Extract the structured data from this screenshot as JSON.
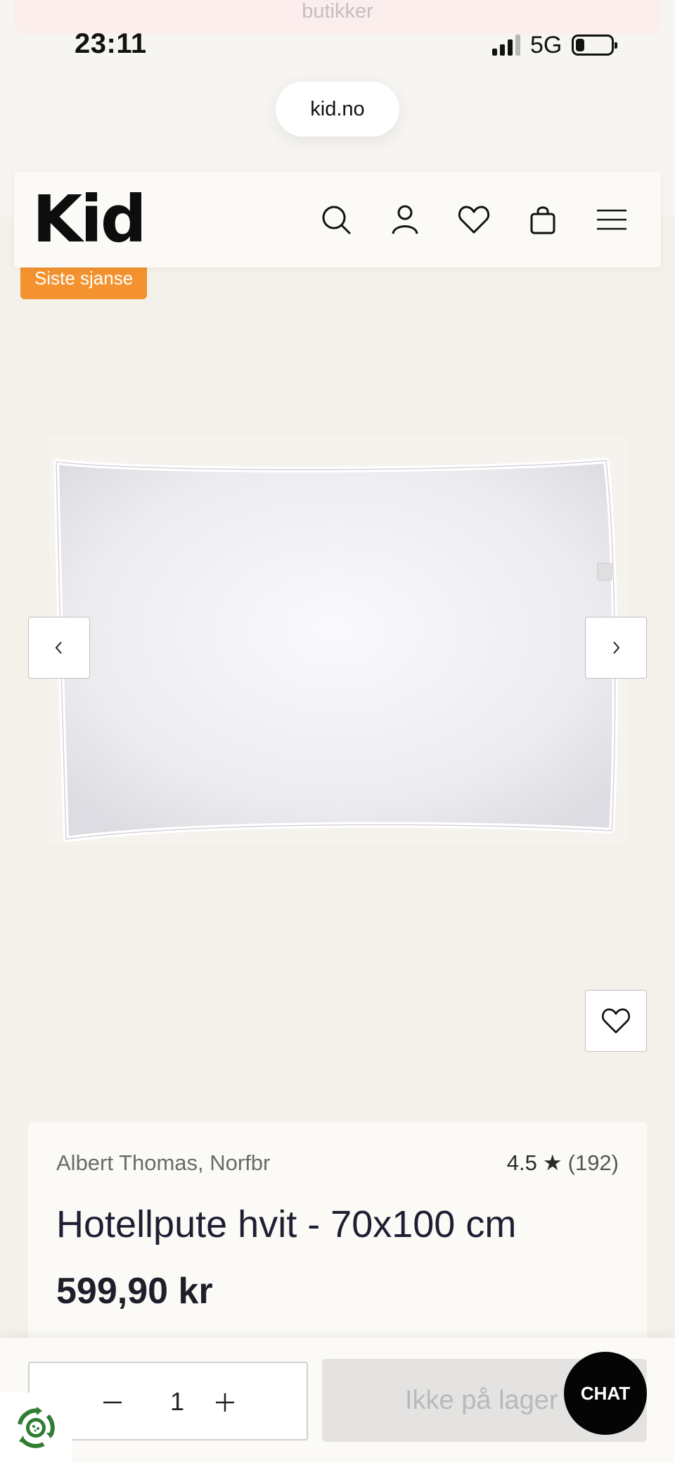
{
  "announcement": {
    "text": "butikker"
  },
  "status_bar": {
    "time": "23:11",
    "network": "5G",
    "battery_level": 0.2
  },
  "browser": {
    "url": "kid.no"
  },
  "header": {
    "logo": "Kid",
    "icons": [
      "search-icon",
      "account-icon",
      "heart-icon",
      "bag-icon",
      "menu-icon"
    ]
  },
  "product": {
    "badge": "Siste sjanse",
    "brand": "Albert Thomas, Norfbr",
    "rating": "4.5",
    "rating_star": "★",
    "review_count": "(192)",
    "title": "Hotellpute hvit - 70x100 cm",
    "price": "599,90 kr"
  },
  "cart": {
    "quantity": "1",
    "stock_label": "Ikke på lager",
    "chat_label": "CHAT"
  },
  "colors": {
    "background": "#f4f1ea",
    "badge": "#f4922f",
    "text": "#1f1f2b",
    "chat": "#050505"
  }
}
